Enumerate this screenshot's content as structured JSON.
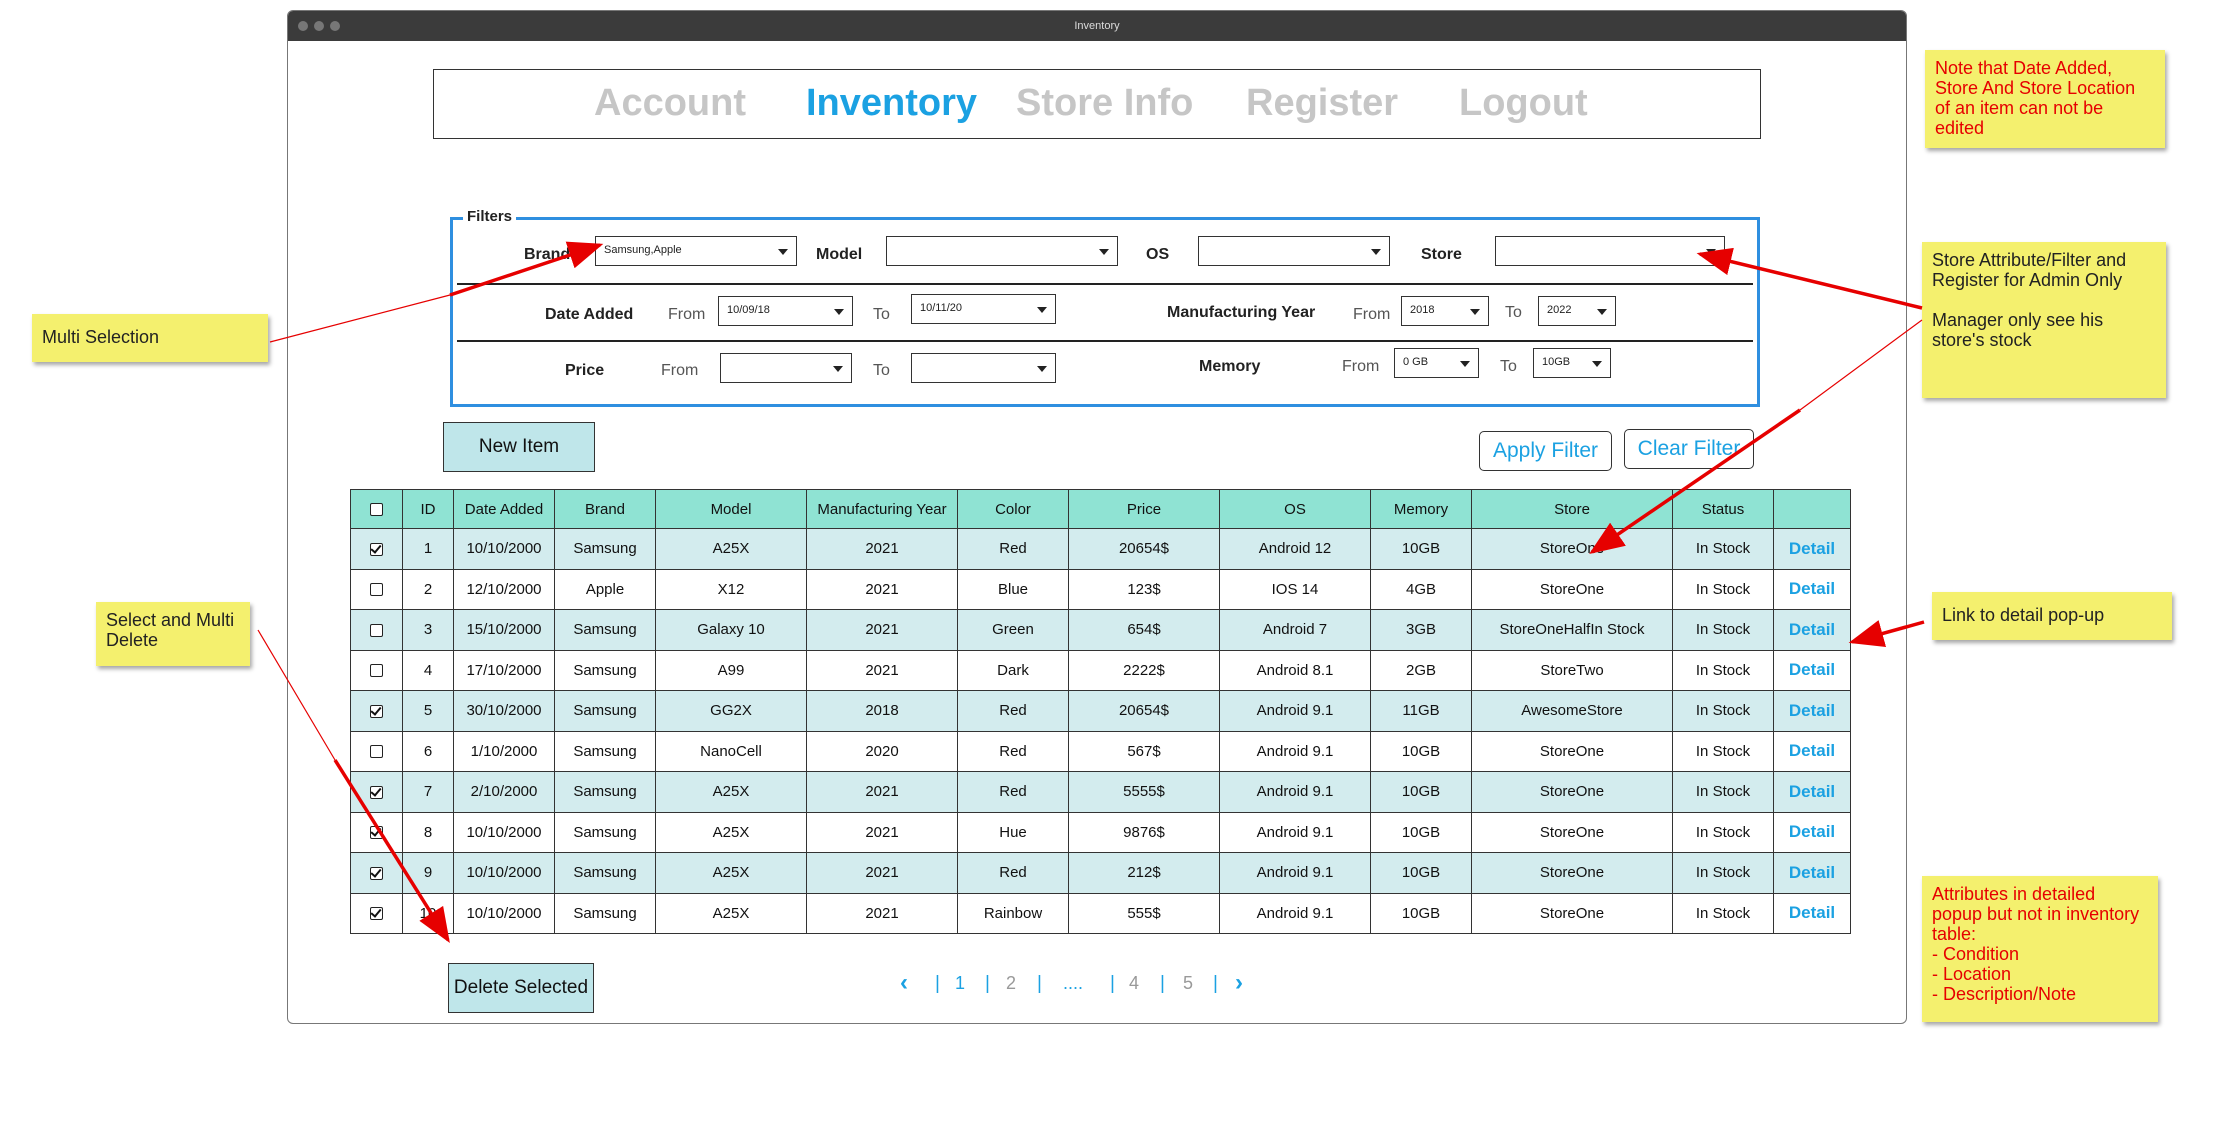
{
  "window": {
    "title": "Inventory"
  },
  "nav": {
    "items": [
      "Account",
      "Inventory",
      "Store Info",
      "Register",
      "Logout"
    ],
    "active": "Inventory"
  },
  "filters": {
    "legend": "Filters",
    "brand": {
      "label": "Brand",
      "value": "Samsung,Apple"
    },
    "model": {
      "label": "Model",
      "value": ""
    },
    "os": {
      "label": "OS",
      "value": ""
    },
    "store": {
      "label": "Store",
      "value": ""
    },
    "date_added": {
      "label": "Date Added",
      "from_label": "From",
      "from": "10/09/18",
      "to_label": "To",
      "to": "10/11/20"
    },
    "manufacturing_year": {
      "label": "Manufacturing Year",
      "from_label": "From",
      "from": "2018",
      "to_label": "To",
      "to": "2022"
    },
    "price": {
      "label": "Price",
      "from_label": "From",
      "from": "",
      "to_label": "To",
      "to": ""
    },
    "memory": {
      "label": "Memory",
      "from_label": "From",
      "from": "0 GB",
      "to_label": "To",
      "to": "10GB"
    }
  },
  "actions": {
    "new_item": "New Item",
    "apply_filter": "Apply Filter",
    "clear_filter": "Clear Filter",
    "delete_selected": "Delete Selected"
  },
  "table": {
    "columns": [
      "ID",
      "Date Added",
      "Brand",
      "Model",
      "Manufacturing Year",
      "Color",
      "Price",
      "OS",
      "Memory",
      "Store",
      "Status",
      ""
    ],
    "detail_label": "Detail",
    "rows": [
      {
        "checked": true,
        "cells": [
          "1",
          "10/10/2000",
          "Samsung",
          "A25X",
          "2021",
          "Red",
          "20654$",
          "Android 12",
          "10GB",
          "StoreOne",
          "In Stock"
        ]
      },
      {
        "checked": false,
        "cells": [
          "2",
          "12/10/2000",
          "Apple",
          "X12",
          "2021",
          "Blue",
          "123$",
          "IOS 14",
          "4GB",
          "StoreOne",
          "In Stock"
        ]
      },
      {
        "checked": false,
        "cells": [
          "3",
          "15/10/2000",
          "Samsung",
          "Galaxy 10",
          "2021",
          "Green",
          "654$",
          "Android 7",
          "3GB",
          "StoreOneHalfIn Stock",
          "In Stock"
        ]
      },
      {
        "checked": false,
        "cells": [
          "4",
          "17/10/2000",
          "Samsung",
          "A99",
          "2021",
          "Dark",
          "2222$",
          "Android 8.1",
          "2GB",
          "StoreTwo",
          "In Stock"
        ]
      },
      {
        "checked": true,
        "cells": [
          "5",
          "30/10/2000",
          "Samsung",
          "GG2X",
          "2018",
          "Red",
          "20654$",
          "Android 9.1",
          "11GB",
          "AwesomeStore",
          "In Stock"
        ]
      },
      {
        "checked": false,
        "cells": [
          "6",
          "1/10/2000",
          "Samsung",
          "NanoCell",
          "2020",
          "Red",
          "567$",
          "Android 9.1",
          "10GB",
          "StoreOne",
          "In Stock"
        ]
      },
      {
        "checked": true,
        "cells": [
          "7",
          "2/10/2000",
          "Samsung",
          "A25X",
          "2021",
          "Red",
          "5555$",
          "Android 9.1",
          "10GB",
          "StoreOne",
          "In Stock"
        ]
      },
      {
        "checked": true,
        "cells": [
          "8",
          "10/10/2000",
          "Samsung",
          "A25X",
          "2021",
          "Hue",
          "9876$",
          "Android 9.1",
          "10GB",
          "StoreOne",
          "In Stock"
        ]
      },
      {
        "checked": true,
        "cells": [
          "9",
          "10/10/2000",
          "Samsung",
          "A25X",
          "2021",
          "Red",
          "212$",
          "Android 9.1",
          "10GB",
          "StoreOne",
          "In Stock"
        ]
      },
      {
        "checked": true,
        "cells": [
          "10",
          "10/10/2000",
          "Samsung",
          "A25X",
          "2021",
          "Rainbow",
          "555$",
          "Android 9.1",
          "10GB",
          "StoreOne",
          "In Stock"
        ]
      }
    ]
  },
  "pagination": {
    "pages": [
      "1",
      "2",
      "....",
      "4",
      "5"
    ],
    "current": "1"
  },
  "notes": {
    "top_right": "Note that Date Added, Store And Store Location of an item can not be edited",
    "multi_selection": "Multi Selection",
    "store_attr": "Store Attribute/Filter and Register for Admin Only\n\nManager only see his store's stock",
    "select_delete": "Select and Multi Delete",
    "detail_link": "Link to detail pop-up",
    "attributes": "Attributes in detailed popup but not in inventory table:\n- Condition\n- Location\n- Description/Note"
  },
  "colors": {
    "accent": "#1ba1e2",
    "header_teal": "#8fe3d3",
    "row_shade": "#d3ecee",
    "note_yellow": "#f4f06e",
    "arrow_red": "#e60000",
    "note_red_text": "#e60000"
  }
}
